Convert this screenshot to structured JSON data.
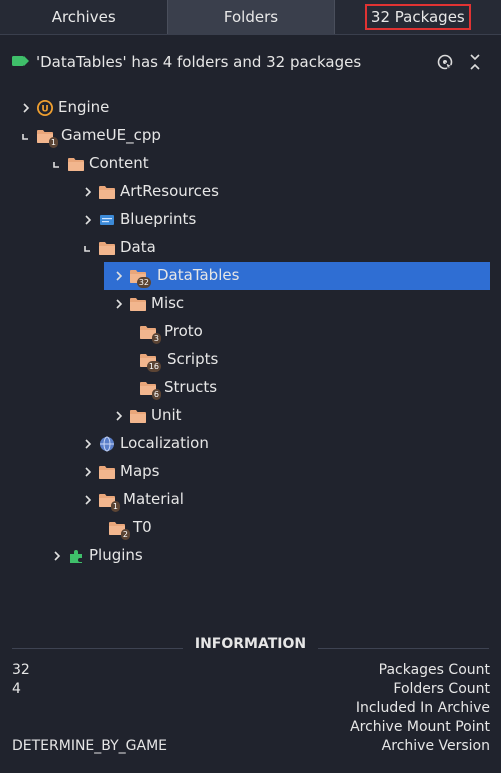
{
  "tabs": [
    {
      "label": "Archives"
    },
    {
      "label": "Folders"
    },
    {
      "label": "32 Packages"
    }
  ],
  "header": {
    "title": "'DataTables' has 4 folders and 32 packages",
    "buttons": [
      "locate-icon",
      "collapse-all-icon"
    ]
  },
  "tree": [
    {
      "label": "Engine",
      "depth": 0,
      "icon": "unreal-engine-icon",
      "expander": "collapsed"
    },
    {
      "label": "GameUE_cpp",
      "depth": 0,
      "icon": "folder-icon",
      "badge": "1",
      "expander": "expanded"
    },
    {
      "label": "Content",
      "depth": 1,
      "icon": "folder-icon",
      "expander": "expanded"
    },
    {
      "label": "ArtResources",
      "depth": 2,
      "icon": "folder-icon",
      "expander": "collapsed"
    },
    {
      "label": "Blueprints",
      "depth": 2,
      "icon": "blueprint-icon",
      "expander": "collapsed"
    },
    {
      "label": "Data",
      "depth": 2,
      "icon": "folder-icon",
      "expander": "expanded"
    },
    {
      "label": "DataTables",
      "depth": 3,
      "icon": "folder-icon",
      "badge": "32",
      "expander": "collapsed",
      "selected": true
    },
    {
      "label": "Misc",
      "depth": 3,
      "icon": "folder-icon",
      "expander": "collapsed"
    },
    {
      "label": "Proto",
      "depth": 3,
      "icon": "folder-icon",
      "badge": "3",
      "expander": "none"
    },
    {
      "label": "Scripts",
      "depth": 3,
      "icon": "folder-icon",
      "badge": "16",
      "expander": "none"
    },
    {
      "label": "Structs",
      "depth": 3,
      "icon": "folder-icon",
      "badge": "6",
      "expander": "none"
    },
    {
      "label": "Unit",
      "depth": 3,
      "icon": "folder-icon",
      "expander": "collapsed"
    },
    {
      "label": "Localization",
      "depth": 2,
      "icon": "globe-icon",
      "expander": "collapsed"
    },
    {
      "label": "Maps",
      "depth": 2,
      "icon": "folder-icon",
      "expander": "collapsed"
    },
    {
      "label": "Material",
      "depth": 2,
      "icon": "folder-icon",
      "badge": "1",
      "expander": "collapsed"
    },
    {
      "label": "T0",
      "depth": 2,
      "icon": "folder-icon",
      "badge": "2",
      "expander": "none"
    },
    {
      "label": "Plugins",
      "depth": 1,
      "icon": "plugin-icon",
      "expander": "collapsed"
    }
  ],
  "information": {
    "title": "INFORMATION",
    "rows": [
      {
        "value": "32",
        "key": "Packages Count"
      },
      {
        "value": "4",
        "key": "Folders Count"
      },
      {
        "value": "",
        "key": "Included In Archive"
      },
      {
        "value": "",
        "key": "Archive Mount Point"
      },
      {
        "value": "DETERMINE_BY_GAME",
        "key": "Archive Version"
      }
    ]
  },
  "colors": {
    "background": "#20232d",
    "selection": "#2f6ed3",
    "folder": "#e9a67a",
    "highlight_border": "#e03333"
  }
}
